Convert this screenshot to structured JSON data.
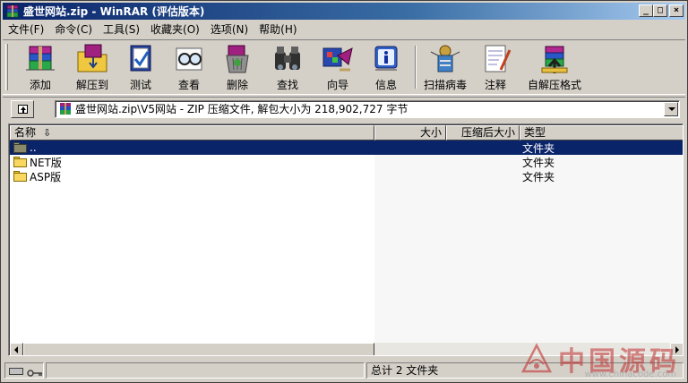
{
  "window": {
    "title": "盛世网站.zip - WinRAR (评估版本)",
    "controls": [
      "_",
      "□",
      "×"
    ]
  },
  "menu": [
    {
      "label": "文件(F)"
    },
    {
      "label": "命令(C)"
    },
    {
      "label": "工具(S)"
    },
    {
      "label": "收藏夹(O)"
    },
    {
      "label": "选项(N)"
    },
    {
      "label": "帮助(H)"
    }
  ],
  "toolbar": [
    {
      "label": "添加",
      "icon": "add-archive-icon"
    },
    {
      "label": "解压到",
      "icon": "extract-to-icon"
    },
    {
      "label": "测试",
      "icon": "test-icon"
    },
    {
      "label": "查看",
      "icon": "view-icon"
    },
    {
      "label": "删除",
      "icon": "delete-icon"
    },
    {
      "label": "查找",
      "icon": "find-icon"
    },
    {
      "label": "向导",
      "icon": "wizard-icon"
    },
    {
      "label": "信息",
      "icon": "info-icon"
    },
    {
      "label": "扫描病毒",
      "icon": "virus-scan-icon"
    },
    {
      "label": "注释",
      "icon": "comment-icon"
    },
    {
      "label": "自解压格式",
      "icon": "sfx-icon"
    }
  ],
  "address": {
    "path": "盛世网站.zip\\V5网站 - ZIP 压缩文件, 解包大小为 218,902,727 字节"
  },
  "columns": {
    "name": "名称",
    "size": "大小",
    "packed": "压缩后大小",
    "type": "类型"
  },
  "files": [
    {
      "name": "..",
      "type": "文件夹",
      "selected": true
    },
    {
      "name": "NET版",
      "type": "文件夹",
      "selected": false
    },
    {
      "name": "ASP版",
      "type": "文件夹",
      "selected": false
    }
  ],
  "status": {
    "total": "总计 2 文件夹"
  },
  "watermark": {
    "text": "中国源码",
    "url": "www.chinacode.com"
  },
  "colors": {
    "title_start": "#0a246a",
    "title_end": "#a6caf0",
    "selection": "#0a246a",
    "chrome": "#d4d0c8"
  }
}
